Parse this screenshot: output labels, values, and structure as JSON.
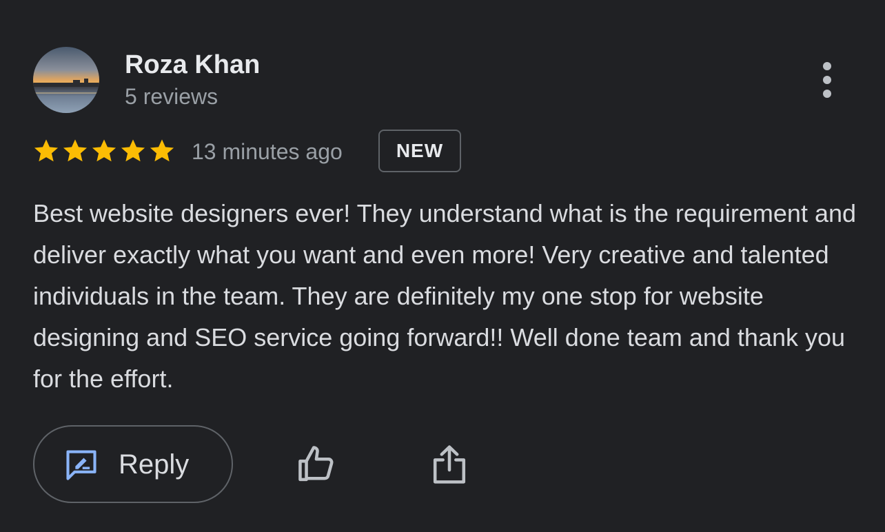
{
  "review": {
    "reviewer_name": "Roza Khan",
    "review_count": "5 reviews",
    "rating": 5,
    "max_rating": 5,
    "timestamp": "13 minutes ago",
    "badge": "NEW",
    "text": "Best website designers ever! They understand what is the requirement and deliver exactly what you want and even more! Very creative and talented individuals in the team. They are definitely my one stop for website designing and SEO service going forward!! Well done team and thank you for the effort."
  },
  "actions": {
    "reply_label": "Reply",
    "reply_icon": "reply-edit-icon",
    "like_icon": "thumbs-up-icon",
    "share_icon": "share-icon",
    "more_icon": "more-vert-icon"
  },
  "colors": {
    "background": "#202124",
    "star": "#fbbc04",
    "reply_icon": "#8ab4f8",
    "primary_text": "#e8eaed",
    "secondary_text": "#9aa0a6"
  }
}
